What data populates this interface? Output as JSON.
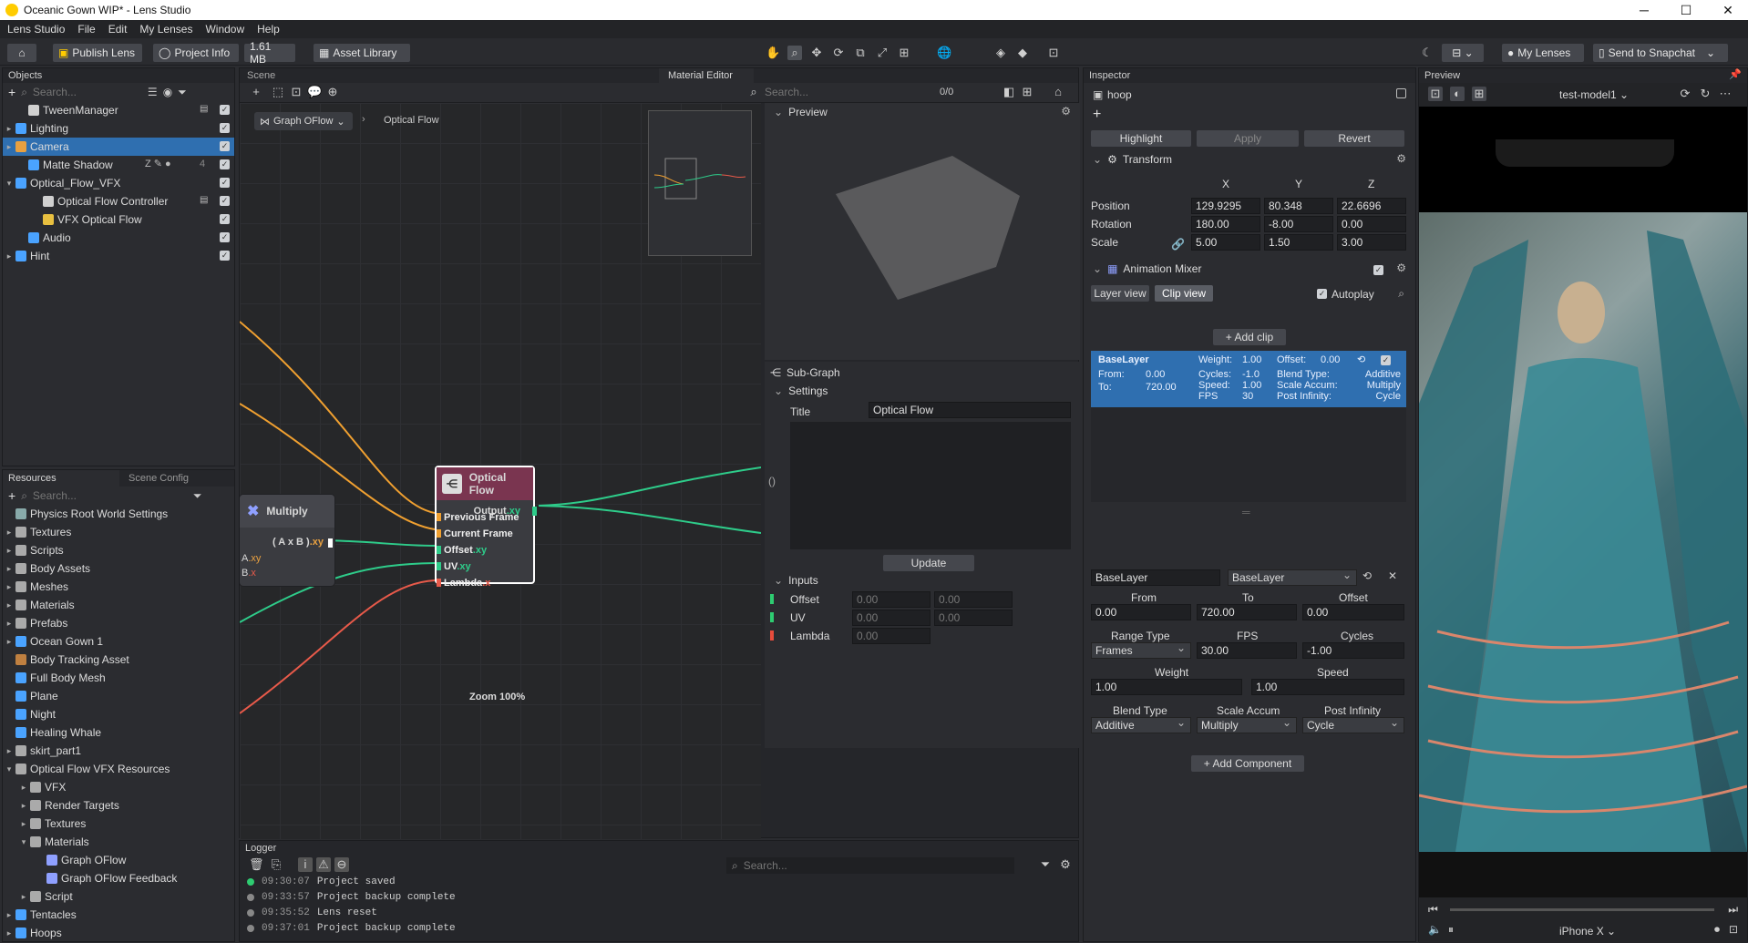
{
  "window": {
    "title": "Oceanic Gown WIP* - Lens Studio",
    "minimize": "─",
    "maximize": "☐",
    "close": "✕"
  },
  "menu": [
    "Lens Studio",
    "File",
    "Edit",
    "My Lenses",
    "Window",
    "Help"
  ],
  "toolbar": {
    "publish_label": "Publish Lens",
    "project_info_label": "Project Info",
    "size_label": "1.61 MB",
    "asset_library_label": "Asset Library",
    "my_lenses_label": "My Lenses",
    "send_label": "Send to Snapchat"
  },
  "objects": {
    "title": "Objects",
    "search_placeholder": "Search...",
    "items": [
      {
        "label": "TweenManager",
        "icon": "script-icon",
        "color": "#d0d0d0"
      },
      {
        "label": "Lighting",
        "icon": "folder-icon",
        "color": "#4aa3ff"
      },
      {
        "label": "Camera",
        "icon": "camera-icon",
        "color": "#e8a040"
      },
      {
        "label": "Matte Shadow",
        "icon": "mesh-icon",
        "color": "#4aa3ff"
      },
      {
        "label": "Optical_Flow_VFX",
        "icon": "folder-icon",
        "color": "#4aa3ff"
      },
      {
        "label": "Optical Flow Controller",
        "icon": "script-icon",
        "color": "#d0d0d0"
      },
      {
        "label": "VFX Optical Flow",
        "icon": "vfx-icon",
        "color": "#e8c040"
      },
      {
        "label": "Audio",
        "icon": "audio-icon",
        "color": "#4aa3ff"
      },
      {
        "label": "Hint",
        "icon": "hint-icon",
        "color": "#4aa3ff"
      }
    ],
    "matte_count": "4"
  },
  "resources": {
    "tab1": "Resources",
    "tab2": "Scene Config",
    "search_placeholder": "Search...",
    "items": [
      {
        "label": "Physics Root World Settings"
      },
      {
        "label": "Textures"
      },
      {
        "label": "Scripts"
      },
      {
        "label": "Body Assets"
      },
      {
        "label": "Meshes"
      },
      {
        "label": "Materials"
      },
      {
        "label": "Prefabs"
      },
      {
        "label": "Ocean Gown 1"
      },
      {
        "label": "Body Tracking Asset"
      },
      {
        "label": "Full Body Mesh"
      },
      {
        "label": "Plane"
      },
      {
        "label": "Night"
      },
      {
        "label": "Healing Whale"
      },
      {
        "label": "skirt_part1"
      },
      {
        "label": "Optical Flow VFX Resources"
      },
      {
        "label": "VFX"
      },
      {
        "label": "Render Targets"
      },
      {
        "label": "Textures"
      },
      {
        "label": "Materials"
      },
      {
        "label": "Graph OFlow"
      },
      {
        "label": "Graph OFlow Feedback"
      },
      {
        "label": "Script"
      },
      {
        "label": "Tentacles"
      },
      {
        "label": "Hoops"
      }
    ]
  },
  "scene": {
    "tab_scene": "Scene",
    "tab_material": "Material Editor",
    "search_placeholder": "Search...",
    "match_count": "0/0",
    "breadcrumb_root": "Graph OFlow",
    "breadcrumb_child": "Optical Flow",
    "zoom": "Zoom 100%",
    "preview_label": "Preview",
    "multiply": {
      "title": "Multiply",
      "output": "( A x B )",
      "output_suffix": ".xy",
      "in_a": "A",
      "in_a_suffix": ".xy",
      "in_b": "B",
      "in_b_suffix": ".x"
    },
    "optical_flow": {
      "title": "Optical Flow",
      "output": "Output",
      "output_suffix": ".xy",
      "inputs": [
        "Previous Frame",
        "Current Frame",
        "Offset",
        "UV",
        "Lambda"
      ],
      "suffixes": [
        "",
        "",
        ".xy",
        ".xy",
        ".x"
      ]
    },
    "subgraph": {
      "title": "Sub-Graph",
      "settings": "Settings",
      "title_label": "Title",
      "title_value": "Optical Flow",
      "update": "Update",
      "inputs_label": "Inputs",
      "inputs": [
        {
          "name": "Offset",
          "a": "0.00",
          "b": "0.00",
          "color": "#2ecc71"
        },
        {
          "name": "UV",
          "a": "0.00",
          "b": "0.00",
          "color": "#2ecc71"
        },
        {
          "name": "Lambda",
          "a": "0.00",
          "color": "#e74c3c"
        }
      ],
      "bracket": "()"
    }
  },
  "logger": {
    "title": "Logger",
    "search_placeholder": "Search...",
    "rows": [
      {
        "time": "09:30:07",
        "msg": "Project saved"
      },
      {
        "time": "09:33:57",
        "msg": "Project backup complete"
      },
      {
        "time": "09:35:52",
        "msg": "Lens reset"
      },
      {
        "time": "09:37:01",
        "msg": "Project backup complete"
      }
    ]
  },
  "inspector": {
    "title": "Inspector",
    "object_name": "hoop",
    "highlight": "Highlight",
    "apply": "Apply",
    "revert": "Revert",
    "transform": "Transform",
    "x": "X",
    "y": "Y",
    "z": "Z",
    "position_label": "Position",
    "position": [
      "129.9295",
      "80.348",
      "22.6696"
    ],
    "rotation_label": "Rotation",
    "rotation": [
      "180.00",
      "-8.00",
      "0.00"
    ],
    "scale_label": "Scale",
    "scale": [
      "5.00",
      "1.50",
      "3.00"
    ],
    "anim_mixer": "Animation Mixer",
    "layer_view": "Layer view",
    "clip_view": "Clip view",
    "autoplay": "Autoplay",
    "add_clip": "Add clip",
    "clip": {
      "name": "BaseLayer",
      "weight_label": "Weight:",
      "weight": "1.00",
      "offset_label": "Offset:",
      "offset": "0.00",
      "from_label": "From:",
      "from": "0.00",
      "to_label": "To:",
      "to": "720.00",
      "cycles_label": "Cycles:",
      "cycles": "-1.0",
      "speed_label": "Speed:",
      "speed": "1.00",
      "fps_label": "FPS",
      "fps": "30",
      "blend_label": "Blend Type:",
      "blend": "Additive",
      "accum_label": "Scale Accum:",
      "accum": "Multiply",
      "postinf_label": "Post Infinity:",
      "postinf": "Cycle"
    },
    "detail": {
      "layer_name": "BaseLayer",
      "layer_select": "BaseLayer",
      "from_label": "From",
      "to_label": "To",
      "offset_label": "Offset",
      "from": "0.00",
      "to": "720.00",
      "offset": "0.00",
      "range_label": "Range Type",
      "fps_label": "FPS",
      "cycles_label": "Cycles",
      "range": "Frames",
      "fps": "30.00",
      "cycles": "-1.00",
      "weight_label": "Weight",
      "speed_label": "Speed",
      "weight": "1.00",
      "speed": "1.00",
      "blend_label": "Blend Type",
      "accum_label": "Scale Accum",
      "postinf_label": "Post Infinity",
      "blend": "Additive",
      "accum": "Multiply",
      "postinf": "Cycle"
    },
    "add_component": "Add Component"
  },
  "preview": {
    "title": "Preview",
    "device_model": "test-model1",
    "device": "iPhone X"
  },
  "colors": {
    "accent": "#4a90e2",
    "selected_row": "#2f6fb0",
    "wire_orange": "#f0a030",
    "wire_green": "#2ecc8a",
    "wire_red": "#e85a4a",
    "node_header": "#7a3550"
  }
}
